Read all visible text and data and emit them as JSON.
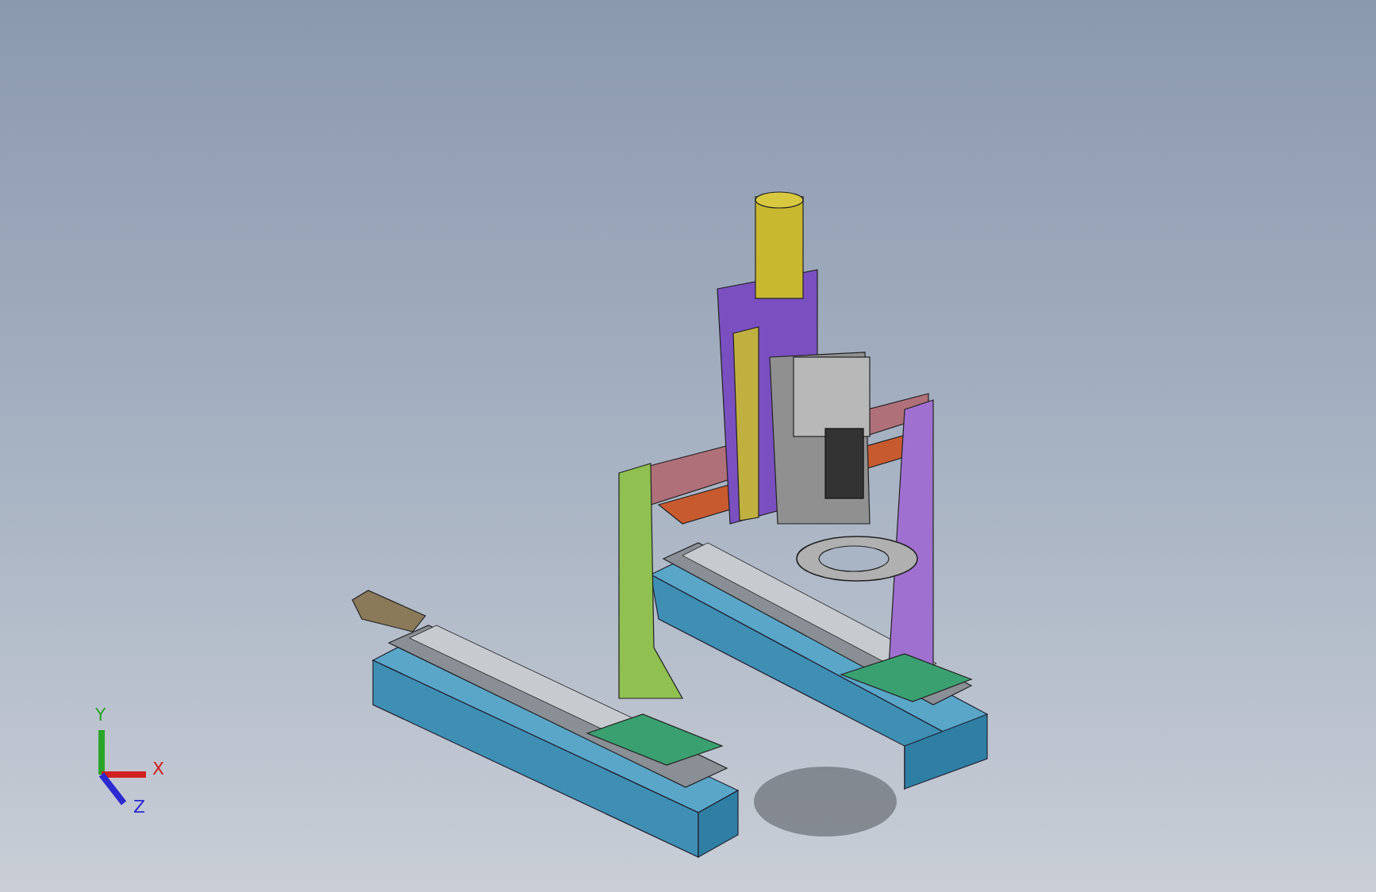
{
  "viewport": {
    "triad": {
      "axes": [
        {
          "kind": "y",
          "label": "Y"
        },
        {
          "kind": "x",
          "label": "X"
        },
        {
          "kind": "z",
          "label": "Z"
        }
      ]
    }
  }
}
